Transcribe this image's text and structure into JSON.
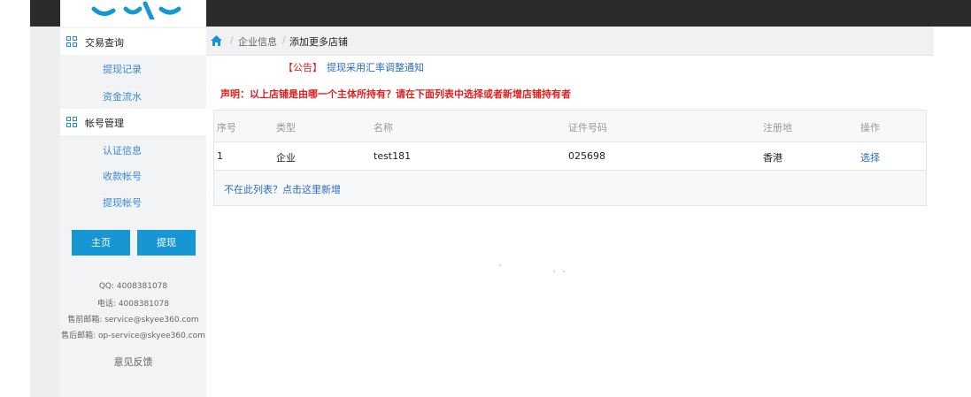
{
  "sidebar": {
    "groups": [
      {
        "label": "交易查询",
        "items": [
          "提现记录",
          "资金流水"
        ]
      },
      {
        "label": "帐号管理",
        "items": [
          "认证信息",
          "收款帐号",
          "提现帐号"
        ]
      }
    ],
    "home_button": "主页",
    "withdraw_button": "提现",
    "contact": {
      "qq": "QQ: 4008381078",
      "phone": "电话: 4008381078",
      "presale_email": "售前邮箱: service@skyee360.com",
      "aftersale_email": "售后邮箱: op-service@skyee360.com"
    },
    "feedback": "意见反馈"
  },
  "breadcrumb": {
    "separator": "/",
    "parent": "企业信息",
    "current": "添加更多店铺"
  },
  "notice": {
    "tag": "【公告】",
    "text": "提现采用汇率调整通知"
  },
  "statement": "声明：以上店铺是由哪一个主体所持有？请在下面列表中选择或者新增店铺持有者",
  "table": {
    "headers": [
      "序号",
      "类型",
      "名称",
      "证件号码",
      "注册地",
      "操作"
    ],
    "rows": [
      {
        "index": "1",
        "type": "企业",
        "name": "test181",
        "id_number": "025698",
        "region": "香港",
        "action": "选择"
      }
    ],
    "add_link": "不在此列表？点击这里新增"
  },
  "colors": {
    "accent": "#1796d4",
    "link": "#2b6cc4",
    "warning": "#e01f1f",
    "topbar": "#2b2b2b"
  }
}
